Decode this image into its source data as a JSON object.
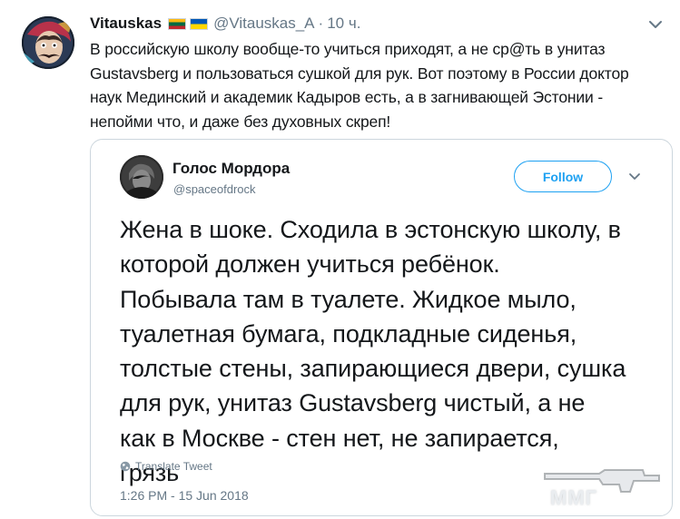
{
  "tweet": {
    "display_name": "Vitauskas",
    "handle": "@Vitauskas_A",
    "separator": "·",
    "time": "10 ч.",
    "flags": [
      "lithuania-flag",
      "ukraine-flag"
    ],
    "text": "В российскую школу вообще-то учиться приходят, а не ср@ть в унитаз\nGustavsberg и пользоваться сушкой для рук. Вот поэтому в России доктор\nнаук Мединский и академик Кадыров есть, а в загнивающей Эстонии -\nнепойми что, и даже без духовных скреп!",
    "menu_icon": "chevron-down-icon"
  },
  "quoted": {
    "display_name": "Голос Мордора",
    "handle": "@spaceofdrock",
    "follow_label": "Follow",
    "text": "Жена в шоке. Сходила в эстонскую школу, в\nкоторой должен учиться ребёнок.\nПобывала там в туалете. Жидкое мыло,\nтуалетная бумага, подкладные сиденья,\nтолстые стены, запирающиеся двери, сушка\nдля рук, унитаз Gustavsberg чистый, а не\nкак в Москве - стен нет, не запирается,\nгрязь",
    "translate_label": "Translate Tweet",
    "timestamp": "1:26 PM - 15 Jun 2018"
  },
  "watermark": {
    "text": "ММГ"
  },
  "colors": {
    "text": "#14171a",
    "secondary": "#657786",
    "accent": "#1da1f2",
    "border": "#ccd6dd"
  }
}
